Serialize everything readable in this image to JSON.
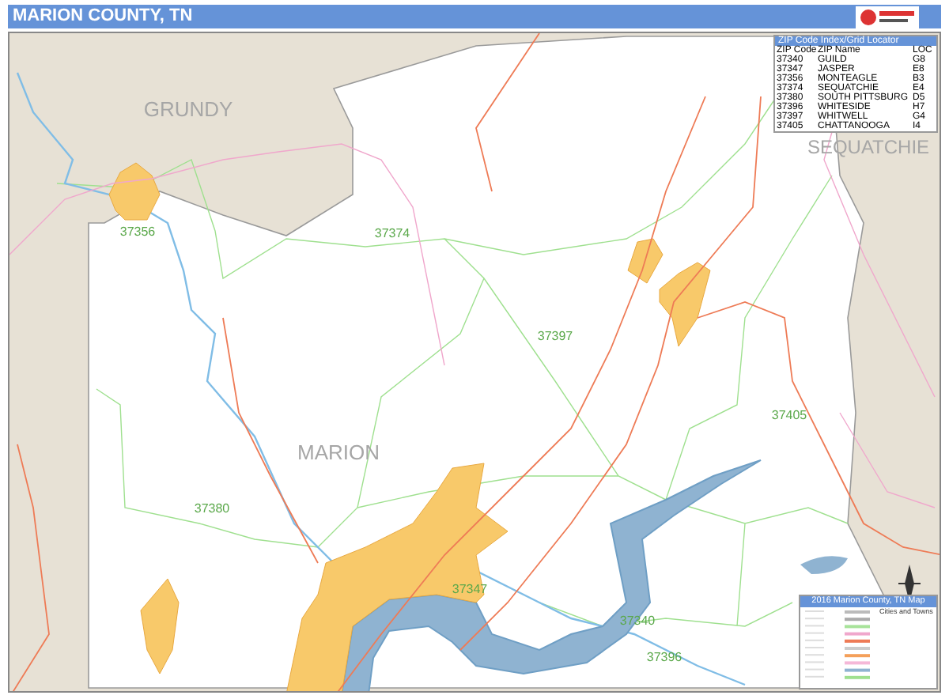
{
  "header": {
    "title": "MARION COUNTY, TN"
  },
  "map": {
    "county_labels": [
      "GRUNDY",
      "SEQUATCHIE",
      "MARION"
    ],
    "zip_labels": [
      "37356",
      "37374",
      "37397",
      "37405",
      "37380",
      "37347",
      "37340",
      "37396"
    ]
  },
  "zip_index": {
    "title": "ZIP Code Index/Grid Locator",
    "columns": [
      "ZIP Code",
      "ZIP Name",
      "LOC"
    ],
    "rows": [
      [
        "37340",
        "GUILD",
        "G8"
      ],
      [
        "37347",
        "JASPER",
        "E8"
      ],
      [
        "37356",
        "MONTEAGLE",
        "B3"
      ],
      [
        "37374",
        "SEQUATCHIE",
        "E4"
      ],
      [
        "37380",
        "SOUTH PITTSBURG",
        "D5"
      ],
      [
        "37396",
        "WHITESIDE",
        "H7"
      ],
      [
        "37397",
        "WHITWELL",
        "G4"
      ],
      [
        "37405",
        "CHATTANOOGA",
        "I4"
      ]
    ]
  },
  "legend": {
    "title": "2016 Marion County, TN Map",
    "section": "Cities and Towns"
  }
}
